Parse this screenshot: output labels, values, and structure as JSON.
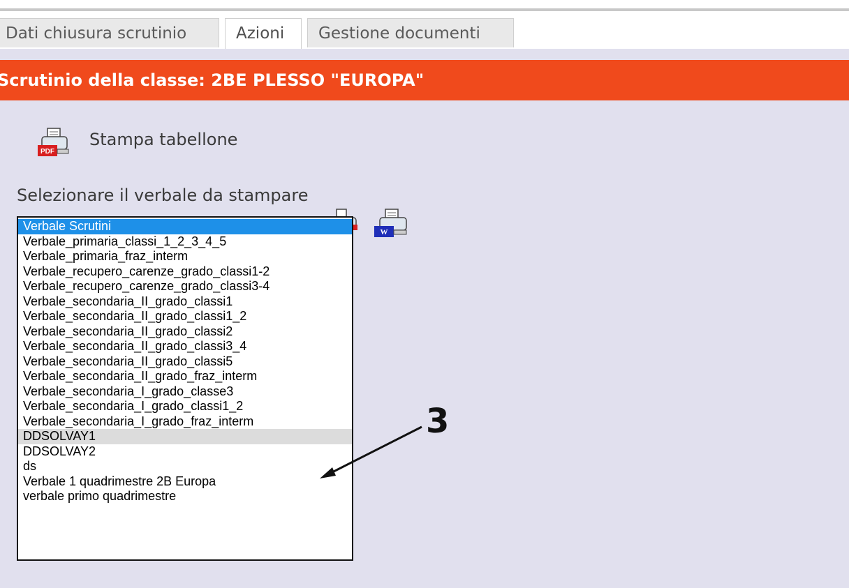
{
  "tabs": [
    {
      "label": "Dati chiusura scrutinio"
    },
    {
      "label": "Azioni",
      "active": true
    },
    {
      "label": "Gestione documenti"
    }
  ],
  "header": {
    "title": "Scrutinio della classe: 2BE PLESSO \"EUROPA\""
  },
  "stampa": {
    "label": "Stampa tabellone",
    "icon": "pdf-printer-icon"
  },
  "verbale": {
    "label": "Selezionare il verbale da stampare",
    "options": [
      "Verbale Scrutini",
      "Verbale_primaria_classi_1_2_3_4_5",
      "Verbale_primaria_fraz_interm",
      "Verbale_recupero_carenze_grado_classi1-2",
      "Verbale_recupero_carenze_grado_classi3-4",
      "Verbale_secondaria_II_grado_classi1",
      "Verbale_secondaria_II_grado_classi1_2",
      "Verbale_secondaria_II_grado_classi2",
      "Verbale_secondaria_II_grado_classi3_4",
      "Verbale_secondaria_II_grado_classi5",
      "Verbale_secondaria_II_grado_fraz_interm",
      "Verbale_secondaria_I_grado_classe3",
      "Verbale_secondaria_I_grado_classi1_2",
      "Verbale_secondaria_I_grado_fraz_interm",
      "DDSOLVAY1",
      "DDSOLVAY2",
      "ds",
      "Verbale 1 quadrimestre 2B Europa",
      "verbale primo quadrimestre"
    ],
    "selected": "Verbale Scrutini",
    "highlighted": "DDSOLVAY1"
  },
  "annotation": {
    "label": "3"
  },
  "colors": {
    "header": "#f04a1c",
    "panel": "#e1e0ee",
    "selected": "#1e90e8",
    "hover": "#dcdcdc"
  }
}
